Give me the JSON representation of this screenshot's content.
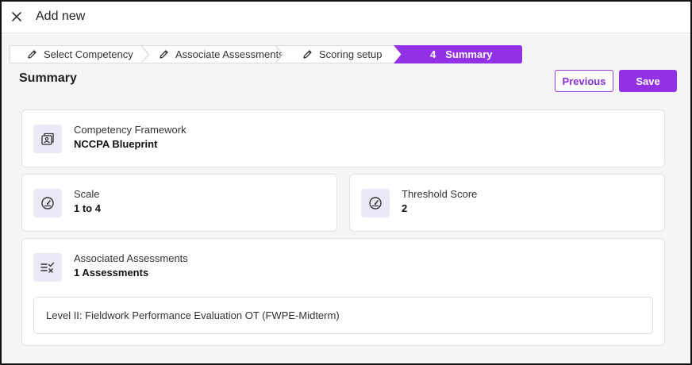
{
  "header": {
    "title": "Add new",
    "close_icon": "close-icon"
  },
  "stepper": {
    "steps": [
      {
        "label": "Select Competency",
        "icon": "pencil-icon",
        "state": "completed"
      },
      {
        "label": "Associate Assessments",
        "icon": "pencil-icon",
        "state": "completed"
      },
      {
        "label": "Scoring setup",
        "icon": "pencil-icon",
        "state": "completed"
      },
      {
        "number": "4",
        "label": "Summary",
        "state": "active"
      }
    ]
  },
  "page": {
    "title": "Summary"
  },
  "actions": {
    "previous_label": "Previous",
    "save_label": "Save"
  },
  "colors": {
    "accent": "#9231e6",
    "icon_bg": "#ebe9f5",
    "page_bg": "#f5f5f5"
  },
  "summary": {
    "framework": {
      "label": "Competency Framework",
      "value": "NCCPA Blueprint",
      "icon": "framework-icon"
    },
    "scale": {
      "label": "Scale",
      "value": "1 to 4",
      "icon": "gauge-icon"
    },
    "threshold": {
      "label": "Threshold Score",
      "value": "2",
      "icon": "gauge-icon"
    },
    "assessments": {
      "label": "Associated Assessments",
      "value": "1 Assessments",
      "icon": "checklist-icon",
      "items": [
        "Level II: Fieldwork Performance Evaluation OT (FWPE-Midterm)"
      ]
    }
  }
}
